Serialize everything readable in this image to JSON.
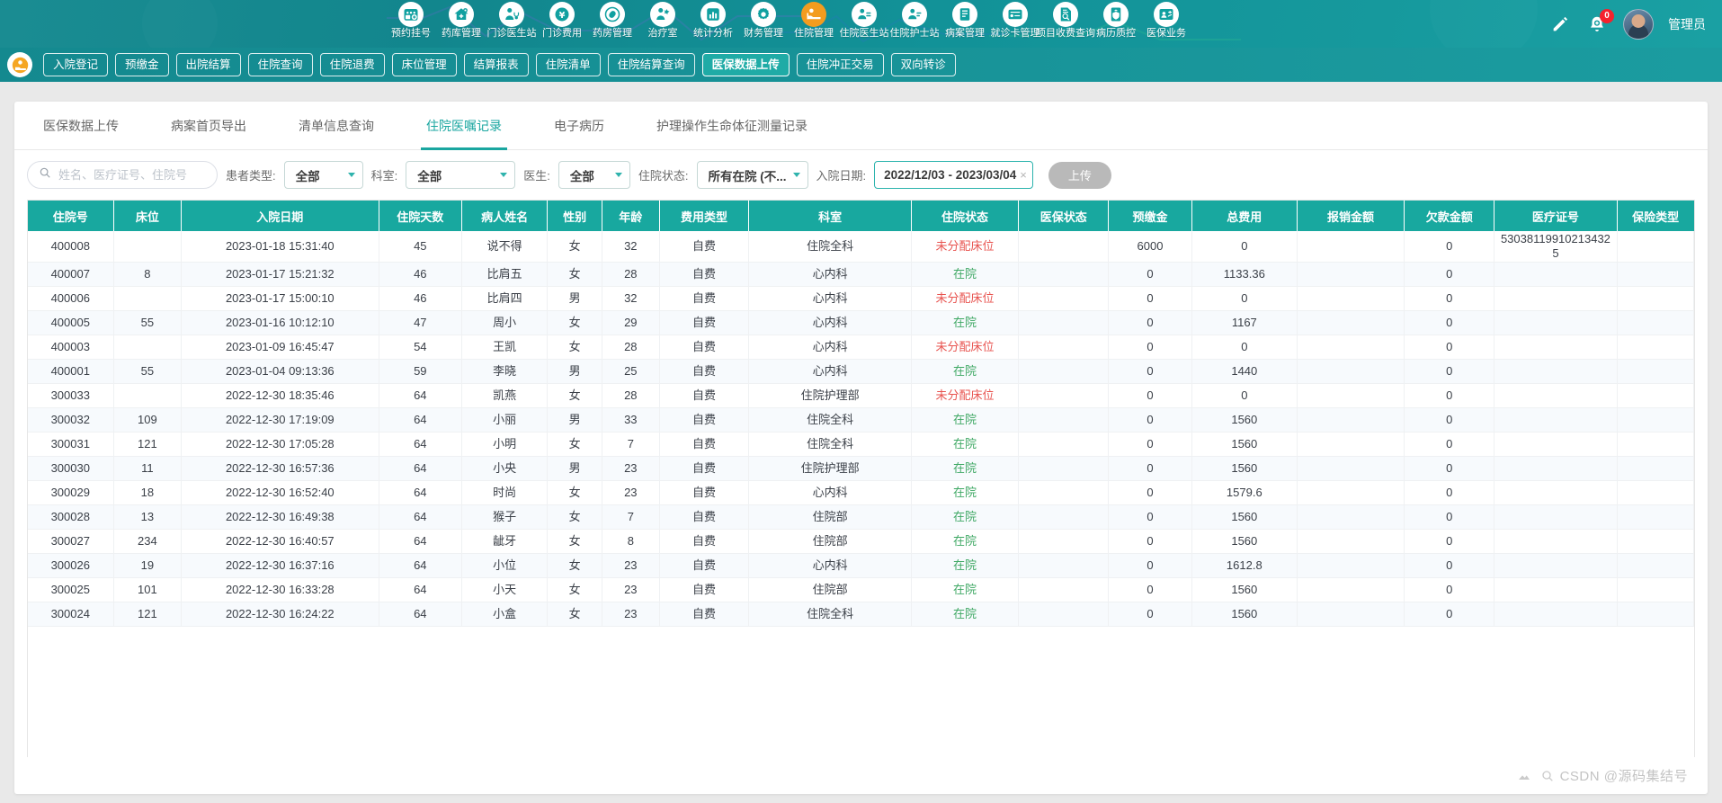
{
  "topnav": {
    "items": [
      {
        "label": "预约挂号",
        "icon": "calendar-plus-icon",
        "active": false
      },
      {
        "label": "药库管理",
        "icon": "pharmacy-house-icon",
        "active": false
      },
      {
        "label": "门诊医生站",
        "icon": "doctor-stethoscope-icon",
        "active": false
      },
      {
        "label": "门诊费用",
        "icon": "yuan-money-icon",
        "active": false
      },
      {
        "label": "药房管理",
        "icon": "capsule-pill-icon",
        "active": false
      },
      {
        "label": "治疗室",
        "icon": "nurse-treatment-icon",
        "active": false
      },
      {
        "label": "统计分析",
        "icon": "bar-chart-icon",
        "active": false
      },
      {
        "label": "财务管理",
        "icon": "gear-finance-icon",
        "active": false
      },
      {
        "label": "住院管理",
        "icon": "hospital-bed-icon",
        "active": true
      },
      {
        "label": "住院医生站",
        "icon": "doctor-card-icon",
        "active": false
      },
      {
        "label": "住院护士站",
        "icon": "nurse-card-icon",
        "active": false
      },
      {
        "label": "病案管理",
        "icon": "medical-record-icon",
        "active": false
      },
      {
        "label": "就诊卡管理",
        "icon": "id-card-icon",
        "active": false
      },
      {
        "label": "项目收费查询",
        "icon": "document-search-icon",
        "active": false
      },
      {
        "label": "病历质控",
        "icon": "shield-quality-icon",
        "active": false
      },
      {
        "label": "医保业务",
        "icon": "insurance-person-icon",
        "active": false
      }
    ],
    "pencil_icon": "pencil-icon",
    "bell_icon": "bell-icon",
    "notification_count": "0",
    "user_name": "管理员",
    "avatar": "user-avatar"
  },
  "subbar": {
    "module_icon": "inpatient-module-icon",
    "buttons": [
      {
        "label": "入院登记",
        "active": false
      },
      {
        "label": "预缴金",
        "active": false
      },
      {
        "label": "出院结算",
        "active": false
      },
      {
        "label": "住院查询",
        "active": false
      },
      {
        "label": "住院退费",
        "active": false
      },
      {
        "label": "床位管理",
        "active": false
      },
      {
        "label": "结算报表",
        "active": false
      },
      {
        "label": "住院清单",
        "active": false
      },
      {
        "label": "住院结算查询",
        "active": false
      },
      {
        "label": "医保数据上传",
        "active": true
      },
      {
        "label": "住院冲正交易",
        "active": false
      },
      {
        "label": "双向转诊",
        "active": false
      }
    ]
  },
  "tabs": [
    {
      "label": "医保数据上传",
      "active": false
    },
    {
      "label": "病案首页导出",
      "active": false
    },
    {
      "label": "清单信息查询",
      "active": false
    },
    {
      "label": "住院医嘱记录",
      "active": true
    },
    {
      "label": "电子病历",
      "active": false
    },
    {
      "label": "护理操作生命体征测量记录",
      "active": false
    }
  ],
  "filters": {
    "search_icon": "search-icon",
    "search_placeholder": "姓名、医疗证号、住院号",
    "search_value": "",
    "patient_type_label": "患者类型:",
    "patient_type_value": "全部",
    "dept_label": "科室:",
    "dept_value": "全部",
    "doctor_label": "医生:",
    "doctor_value": "全部",
    "state_label": "住院状态:",
    "state_value": "所有在院 (不...",
    "date_label": "入院日期:",
    "date_value": "2022/12/03 - 2023/03/04",
    "date_clear": "×",
    "upload_button": "上传"
  },
  "table": {
    "columns": [
      "住院号",
      "床位",
      "入院日期",
      "住院天数",
      "病人姓名",
      "性别",
      "年龄",
      "费用类型",
      "科室",
      "住院状态",
      "医保状态",
      "预缴金",
      "总费用",
      "报销金额",
      "欠款金额",
      "医疗证号",
      "保险类型"
    ],
    "rows": [
      [
        "400008",
        "",
        "2023-01-18 15:31:40",
        "45",
        "说不得",
        "女",
        "32",
        "自费",
        "住院全科",
        "未分配床位",
        "",
        "6000",
        "0",
        "",
        "0",
        "530381199102134325",
        ""
      ],
      [
        "400007",
        "8",
        "2023-01-17 15:21:32",
        "46",
        "比肩五",
        "女",
        "28",
        "自费",
        "心内科",
        "在院",
        "",
        "0",
        "1133.36",
        "",
        "0",
        "",
        ""
      ],
      [
        "400006",
        "",
        "2023-01-17 15:00:10",
        "46",
        "比肩四",
        "男",
        "32",
        "自费",
        "心内科",
        "未分配床位",
        "",
        "0",
        "0",
        "",
        "0",
        "",
        ""
      ],
      [
        "400005",
        "55",
        "2023-01-16 10:12:10",
        "47",
        "周小",
        "女",
        "29",
        "自费",
        "心内科",
        "在院",
        "",
        "0",
        "1167",
        "",
        "0",
        "",
        ""
      ],
      [
        "400003",
        "",
        "2023-01-09 16:45:47",
        "54",
        "王凯",
        "女",
        "28",
        "自费",
        "心内科",
        "未分配床位",
        "",
        "0",
        "0",
        "",
        "0",
        "",
        ""
      ],
      [
        "400001",
        "55",
        "2023-01-04 09:13:36",
        "59",
        "李晓",
        "男",
        "25",
        "自费",
        "心内科",
        "在院",
        "",
        "0",
        "1440",
        "",
        "0",
        "",
        ""
      ],
      [
        "300033",
        "",
        "2022-12-30 18:35:46",
        "64",
        "凯燕",
        "女",
        "28",
        "自费",
        "住院护理部",
        "未分配床位",
        "",
        "0",
        "0",
        "",
        "0",
        "",
        ""
      ],
      [
        "300032",
        "109",
        "2022-12-30 17:19:09",
        "64",
        "小丽",
        "男",
        "33",
        "自费",
        "住院全科",
        "在院",
        "",
        "0",
        "1560",
        "",
        "0",
        "",
        ""
      ],
      [
        "300031",
        "121",
        "2022-12-30 17:05:28",
        "64",
        "小明",
        "女",
        "7",
        "自费",
        "住院全科",
        "在院",
        "",
        "0",
        "1560",
        "",
        "0",
        "",
        ""
      ],
      [
        "300030",
        "11",
        "2022-12-30 16:57:36",
        "64",
        "小央",
        "男",
        "23",
        "自费",
        "住院护理部",
        "在院",
        "",
        "0",
        "1560",
        "",
        "0",
        "",
        ""
      ],
      [
        "300029",
        "18",
        "2022-12-30 16:52:40",
        "64",
        "时尚",
        "女",
        "23",
        "自费",
        "心内科",
        "在院",
        "",
        "0",
        "1579.6",
        "",
        "0",
        "",
        ""
      ],
      [
        "300028",
        "13",
        "2022-12-30 16:49:38",
        "64",
        "猴子",
        "女",
        "7",
        "自费",
        "住院部",
        "在院",
        "",
        "0",
        "1560",
        "",
        "0",
        "",
        ""
      ],
      [
        "300027",
        "234",
        "2022-12-30 16:40:57",
        "64",
        "龇牙",
        "女",
        "8",
        "自费",
        "住院部",
        "在院",
        "",
        "0",
        "1560",
        "",
        "0",
        "",
        ""
      ],
      [
        "300026",
        "19",
        "2022-12-30 16:37:16",
        "64",
        "小位",
        "女",
        "23",
        "自费",
        "心内科",
        "在院",
        "",
        "0",
        "1612.8",
        "",
        "0",
        "",
        ""
      ],
      [
        "300025",
        "101",
        "2022-12-30 16:33:28",
        "64",
        "小天",
        "女",
        "23",
        "自费",
        "住院部",
        "在院",
        "",
        "0",
        "1560",
        "",
        "0",
        "",
        ""
      ],
      [
        "300024",
        "121",
        "2022-12-30 16:24:22",
        "64",
        "小盒",
        "女",
        "23",
        "自费",
        "住院全科",
        "在院",
        "",
        "0",
        "1560",
        "",
        "0",
        "",
        ""
      ]
    ]
  },
  "watermark": {
    "text": "CSDN @源码集结号"
  },
  "colors": {
    "brand": "#18a89f",
    "nav_bg": "#129298",
    "active_nav": "#f39c1f",
    "status_red": "#e8534f",
    "status_green": "#3fa864",
    "badge_red": "#f5222d"
  }
}
